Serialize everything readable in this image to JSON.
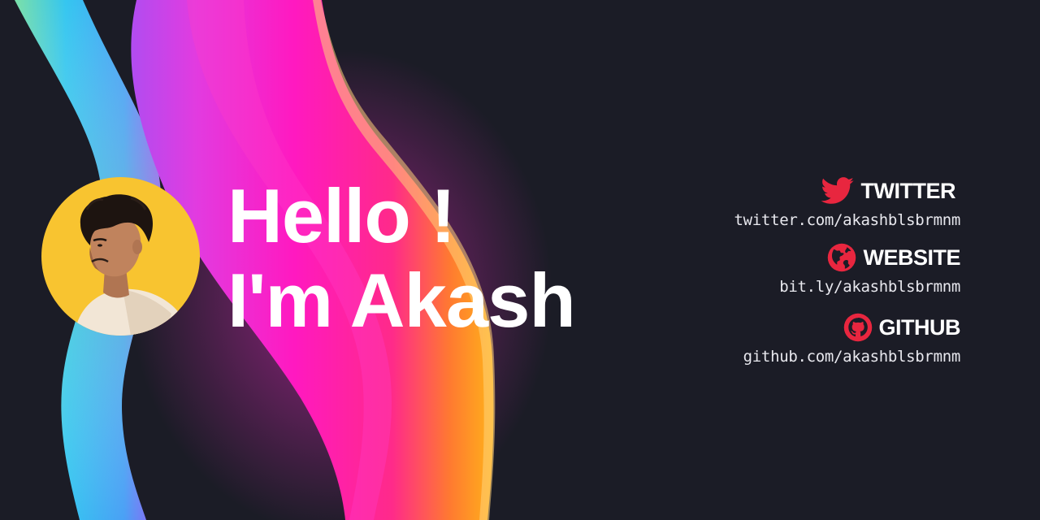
{
  "greeting": {
    "line1": "Hello !",
    "line2": "I'm Akash"
  },
  "links": [
    {
      "label": "TWITTER",
      "icon": "twitter-bird-icon",
      "url": "twitter.com/akashblsbrmnm"
    },
    {
      "label": "WEBSITE",
      "icon": "globe-icon",
      "url": "bit.ly/akashblsbrmnm"
    },
    {
      "label": "GITHUB",
      "icon": "github-octocat-icon",
      "url": "github.com/akashblsbrmnm"
    }
  ],
  "colors": {
    "background": "#1b1c26",
    "icon_accent": "#e8263f",
    "avatar_background": "#f8c430",
    "text": "#ffffff"
  }
}
